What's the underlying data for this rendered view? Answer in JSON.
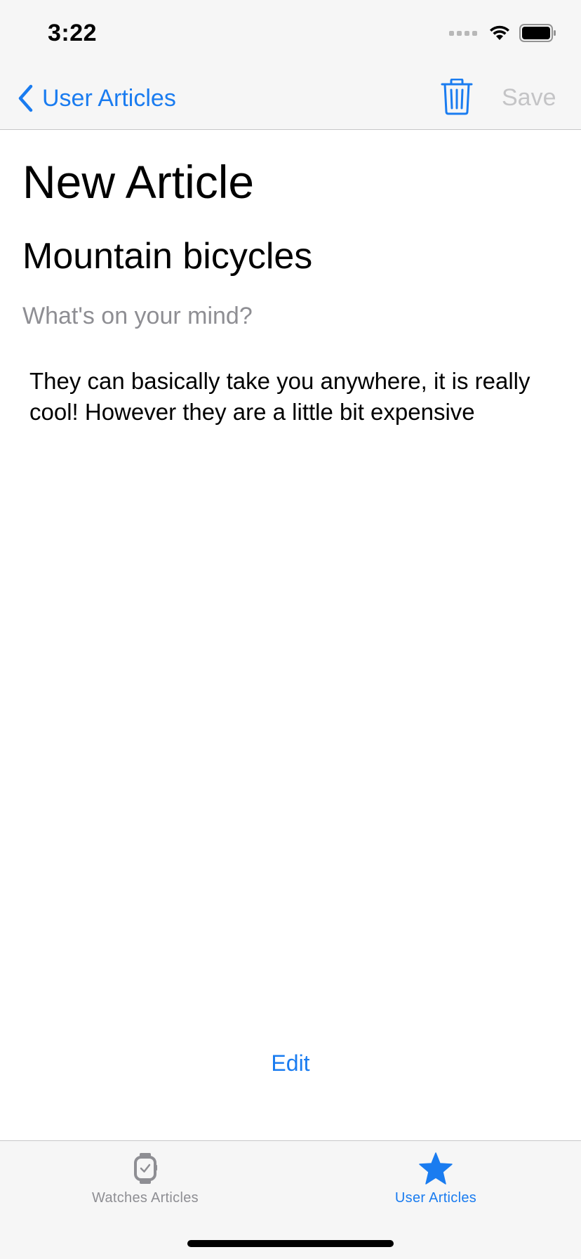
{
  "status_bar": {
    "time": "3:22"
  },
  "nav": {
    "back_label": "User Articles",
    "save_label": "Save"
  },
  "article": {
    "heading": "New Article",
    "title_value": "Mountain bicycles",
    "subtitle_placeholder": "What's on your mind?",
    "body_value": "They can basically take you anywhere, it is really cool! However they are a little bit expensive"
  },
  "edit_label": "Edit",
  "tabs": [
    {
      "label": "Watches Articles",
      "icon": "watch-icon",
      "selected": false
    },
    {
      "label": "User Articles",
      "icon": "star-icon",
      "selected": true
    }
  ],
  "colors": {
    "accent": "#1a7cf0",
    "disabled": "#c4c4c6",
    "placeholder": "#8e8e93",
    "bar_bg": "#f6f6f6"
  }
}
